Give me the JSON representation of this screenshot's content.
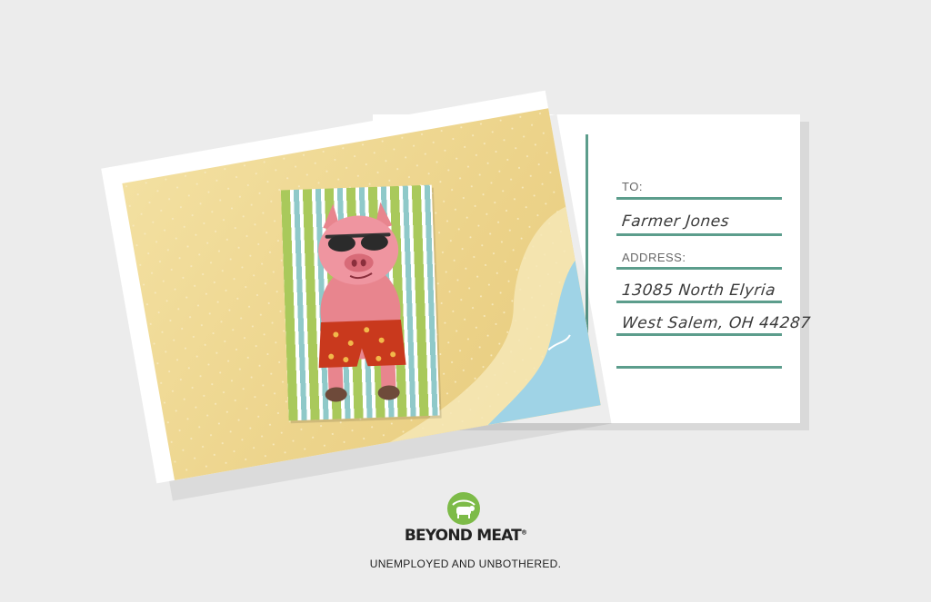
{
  "postcard": {
    "to_label": "TO:",
    "to_value": "Farmer Jones",
    "address_label": "ADDRESS:",
    "address_line1": "13085 North Elyria",
    "address_line2": "West Salem, OH 44287"
  },
  "brand": {
    "name": "BEYOND MEAT",
    "registered_mark": "®",
    "tagline": "UNEMPLOYED AND UNBOTHERED.",
    "logo_icon": "cow-logo-icon"
  },
  "colors": {
    "background": "#ececec",
    "sand": "#ecd38a",
    "towel_green": "#a9c95b",
    "towel_blue": "#8fc9c9",
    "line_teal": "#5c9d8c",
    "pig_pink": "#e8858e",
    "shorts_red": "#c9391d",
    "water": "#9fd3e6",
    "brand_green": "#7dbb48"
  }
}
